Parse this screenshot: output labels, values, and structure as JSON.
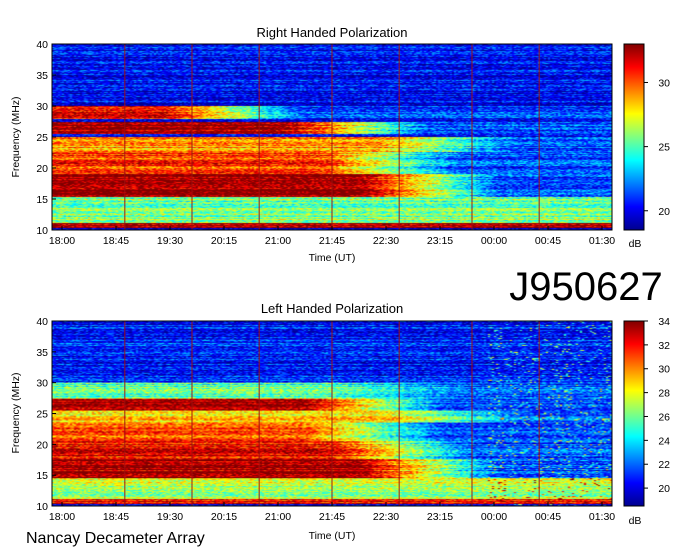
{
  "page": {
    "observation_id": "J950627",
    "instrument": "Nancay Decameter Array"
  },
  "colors": {
    "colormap": [
      "#00008f",
      "#0000ff",
      "#0080ff",
      "#00ffff",
      "#80ff80",
      "#ffff00",
      "#ff8000",
      "#ff0000",
      "#800000"
    ],
    "time_marker": "#a01010",
    "background": "#ffffff"
  },
  "chart_data": [
    {
      "type": "heatmap",
      "title": "Right Handed Polarization",
      "xlabel": "Time (UT)",
      "ylabel": "Frequency (MHz)",
      "x_ticks": [
        "18:00",
        "18:45",
        "19:30",
        "20:15",
        "21:00",
        "21:45",
        "22:30",
        "23:15",
        "00:00",
        "00:45",
        "01:30"
      ],
      "y_ticks": [
        10,
        15,
        20,
        25,
        30,
        35,
        40
      ],
      "ylim": [
        10,
        40
      ],
      "colorbar": {
        "label": "dB",
        "ticks": [
          20,
          25,
          30
        ],
        "range": [
          18.5,
          33
        ]
      },
      "emission_bands": [
        {
          "fmin": 10.3,
          "fmax": 11.0,
          "level": 0.95,
          "t_end": 1.0
        },
        {
          "fmin": 11.0,
          "fmax": 15.2,
          "level": 0.5,
          "t_end": 1.0
        },
        {
          "fmin": 15.2,
          "fmax": 19.0,
          "level": 0.98,
          "t_end": 0.55
        },
        {
          "fmin": 19.0,
          "fmax": 22.5,
          "level": 0.82,
          "t_end": 0.48
        },
        {
          "fmin": 22.5,
          "fmax": 25.0,
          "level": 0.72,
          "t_end": 0.58
        },
        {
          "fmin": 25.5,
          "fmax": 27.5,
          "level": 0.97,
          "t_end": 0.42
        },
        {
          "fmin": 28.0,
          "fmax": 30.0,
          "level": 0.9,
          "t_end": 0.2
        },
        {
          "fmin": 30.0,
          "fmax": 40.0,
          "level": 0.12,
          "t_end": 1.0
        }
      ]
    },
    {
      "type": "heatmap",
      "title": "Left Handed Polarization",
      "xlabel": "Time (UT)",
      "ylabel": "Frequency (MHz)",
      "x_ticks": [
        "18:00",
        "18:45",
        "19:30",
        "20:15",
        "21:00",
        "21:45",
        "22:30",
        "23:15",
        "00:00",
        "00:45",
        "01:30"
      ],
      "y_ticks": [
        10,
        15,
        20,
        25,
        30,
        35,
        40
      ],
      "ylim": [
        10,
        40
      ],
      "colorbar": {
        "label": "dB",
        "ticks": [
          20,
          22,
          24,
          26,
          28,
          30,
          32,
          34
        ],
        "range": [
          18.5,
          34
        ]
      },
      "emission_bands": [
        {
          "fmin": 10.3,
          "fmax": 11.0,
          "level": 0.9,
          "t_end": 1.0
        },
        {
          "fmin": 11.0,
          "fmax": 14.5,
          "level": 0.55,
          "t_end": 1.0
        },
        {
          "fmin": 14.5,
          "fmax": 17.5,
          "level": 0.97,
          "t_end": 0.55
        },
        {
          "fmin": 17.5,
          "fmax": 20.5,
          "level": 0.88,
          "t_end": 0.5
        },
        {
          "fmin": 20.5,
          "fmax": 23.5,
          "level": 0.8,
          "t_end": 0.45
        },
        {
          "fmin": 23.5,
          "fmax": 25.5,
          "level": 0.65,
          "t_end": 0.6
        },
        {
          "fmin": 25.5,
          "fmax": 27.5,
          "level": 0.97,
          "t_end": 0.45
        },
        {
          "fmin": 27.5,
          "fmax": 30.0,
          "level": 0.45,
          "t_end": 0.5
        },
        {
          "fmin": 30.0,
          "fmax": 40.0,
          "level": 0.15,
          "t_end": 1.0
        }
      ]
    }
  ]
}
